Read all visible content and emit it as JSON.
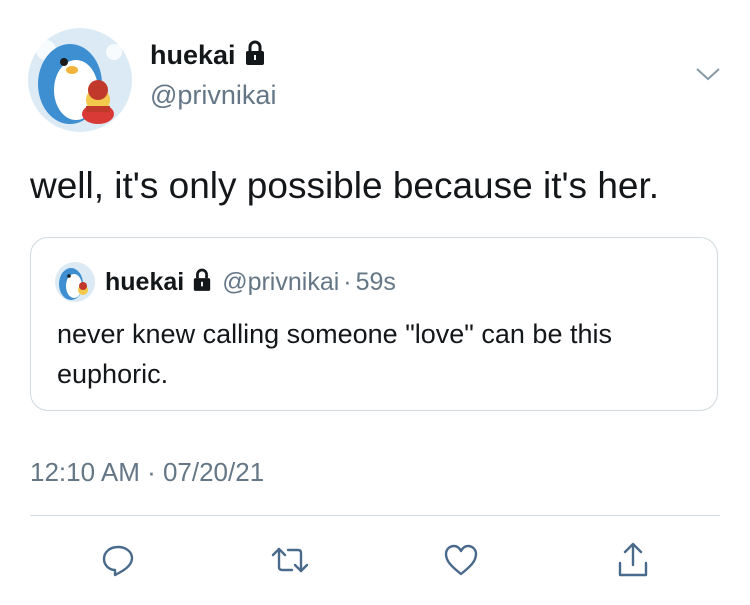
{
  "tweet": {
    "author": {
      "display_name": "huekai",
      "handle": "@privnikai",
      "avatar_icon": "penguin-avatar",
      "locked_icon": "lock-icon"
    },
    "text": "well, it's only possible because it's her.",
    "quoted": {
      "display_name": "huekai",
      "handle": "@privnikai",
      "separator": "·",
      "time_ago": "59s",
      "text": "never knew calling someone \"love\" can be this euphoric."
    },
    "timestamp": "12:10 AM · 07/20/21"
  },
  "actions": {
    "reply_icon": "reply-icon",
    "retweet_icon": "retweet-icon",
    "like_icon": "heart-icon",
    "share_icon": "share-icon",
    "more_icon": "chevron-down-icon"
  },
  "colors": {
    "primary_text": "#14171a",
    "secondary_text": "#657786",
    "border": "#cfd9de",
    "icon": "#4a6a8c"
  }
}
